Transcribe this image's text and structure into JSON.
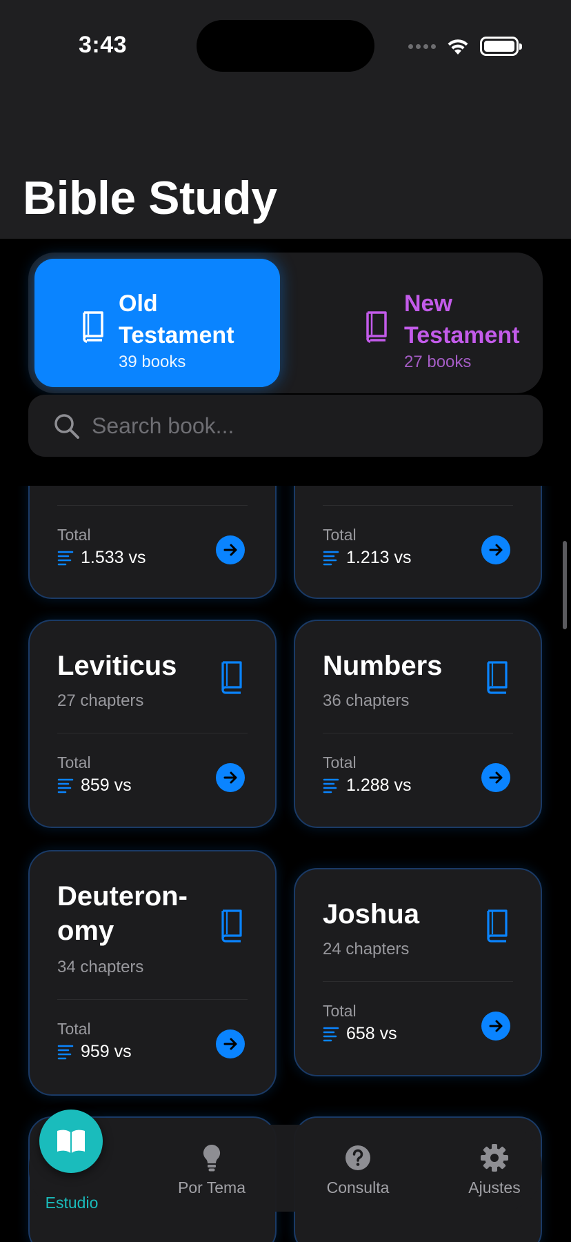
{
  "status": {
    "time": "3:43"
  },
  "header": {
    "title": "Bible Study"
  },
  "testaments": [
    {
      "title_line1": "Old",
      "title_line2": "Testament",
      "count": "39 books",
      "selected": true,
      "color": "#0a84ff"
    },
    {
      "title_line1": "New",
      "title_line2": "Testament",
      "count": "27 books",
      "selected": false,
      "color": "#c35bea"
    }
  ],
  "search": {
    "placeholder": "Search book..."
  },
  "cards": [
    {
      "name": "",
      "chapters": "",
      "total_label": "Total",
      "verses": "1.533 vs"
    },
    {
      "name": "",
      "chapters": "",
      "total_label": "Total",
      "verses": "1.213 vs"
    },
    {
      "name": "Leviticus",
      "chapters": "27 chapters",
      "total_label": "Total",
      "verses": "859 vs"
    },
    {
      "name": "Numbers",
      "chapters": "36 chapters",
      "total_label": "Total",
      "verses": "1.288 vs"
    },
    {
      "name_line1": "Deuteron-",
      "name_line2": "omy",
      "chapters": "34 chapters",
      "total_label": "Total",
      "verses": "959 vs"
    },
    {
      "name": "Joshua",
      "chapters": "24 chapters",
      "total_label": "Total",
      "verses": "658 vs"
    }
  ],
  "tabs": [
    {
      "label": "Estudio",
      "icon": "open-book-icon",
      "active": true
    },
    {
      "label": "Por Tema",
      "icon": "lightbulb-icon",
      "active": false
    },
    {
      "label": "Consulta",
      "icon": "question-circle-icon",
      "active": false
    },
    {
      "label": "Ajustes",
      "icon": "gear-icon",
      "active": false
    }
  ],
  "colors": {
    "accent": "#0a84ff",
    "new_testament": "#c35bea",
    "tab_active": "#1abcbc"
  }
}
